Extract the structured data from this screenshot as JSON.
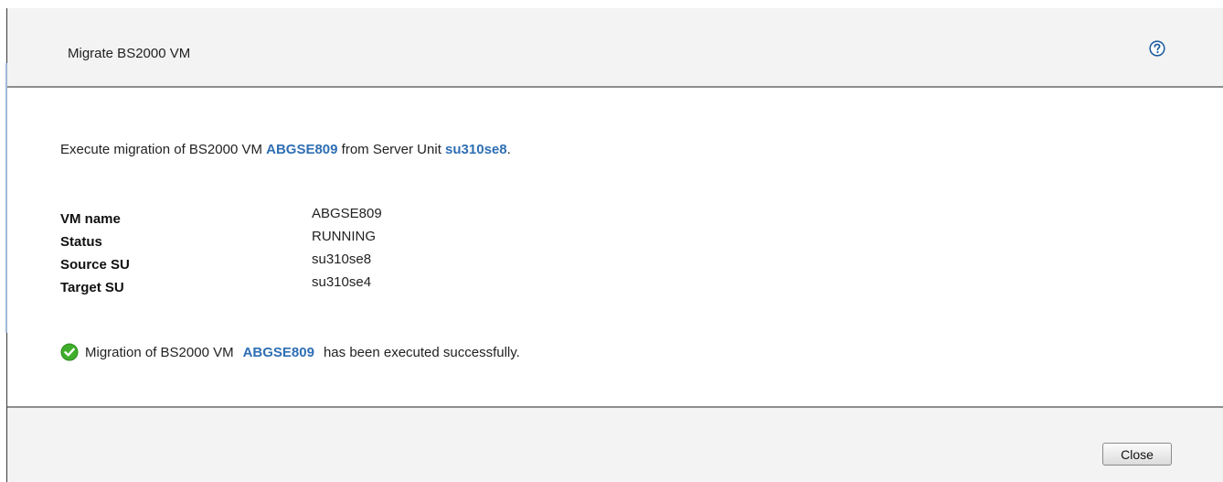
{
  "dialog": {
    "title": "Migrate BS2000 VM",
    "help_icon": "question-circle-icon"
  },
  "intro": {
    "prefix": "Execute migration of BS2000 VM ",
    "vm_link": "ABGSE809",
    "middle": " from Server Unit ",
    "su_link": "su310se8",
    "suffix": "."
  },
  "properties": [
    {
      "label": "VM name",
      "value": "ABGSE809"
    },
    {
      "label": "Status",
      "value": "RUNNING"
    },
    {
      "label": "Source SU",
      "value": "su310se8"
    },
    {
      "label": "Target SU",
      "value": "su310se4"
    }
  ],
  "result": {
    "icon": "check-circle-icon",
    "prefix": "Migration of BS2000 VM",
    "vm_link": "ABGSE809",
    "suffix": "has been executed successfully."
  },
  "footer": {
    "close_label": "Close"
  },
  "colors": {
    "link": "#2f6fb3",
    "header_bg": "#f3f3f3",
    "success_green": "#3fae2a"
  }
}
